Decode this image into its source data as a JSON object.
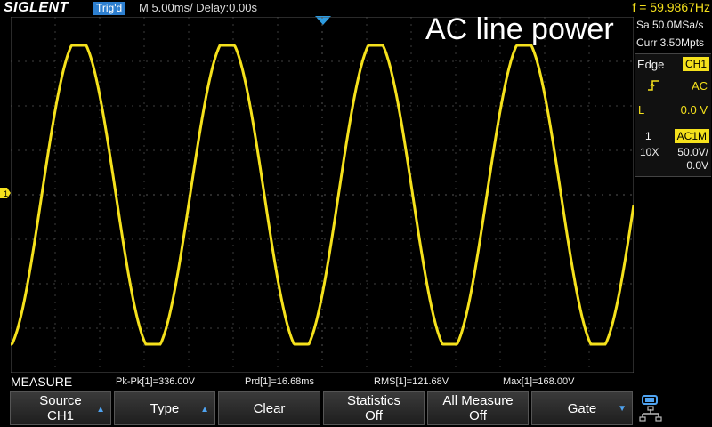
{
  "header": {
    "brand": "SIGLENT",
    "trigger_status": "Trig'd",
    "timebase": "M 5.00ms/ Delay:0.00s",
    "frequency": "f = 59.9867Hz"
  },
  "overlay_title": "AC line power",
  "acquisition": {
    "sample_rate": "Sa 50.0MSa/s",
    "memory": "Curr 3.50Mpts"
  },
  "trigger_panel": {
    "type": "Edge",
    "source": "CH1",
    "slope_icon": "rising-edge-icon",
    "coupling": "AC",
    "level_label": "L",
    "level_value": "0.0 V"
  },
  "channel_panel": {
    "number": "1",
    "coupling": "AC1M",
    "probe": "10X",
    "volts_per_div": "50.0V/",
    "offset": "0.0V"
  },
  "measure": {
    "title": "MEASURE",
    "items": [
      {
        "label": "Pk-Pk[1]=336.00V"
      },
      {
        "label": "Prd[1]=16.68ms"
      },
      {
        "label": "RMS[1]=121.68V"
      },
      {
        "label": "Max[1]=168.00V"
      }
    ]
  },
  "softkeys": [
    {
      "line1": "Source",
      "line2": "CH1",
      "arrow": "up"
    },
    {
      "line1": "Type",
      "line2": "",
      "arrow": "up"
    },
    {
      "line1": "Clear",
      "line2": "",
      "arrow": ""
    },
    {
      "line1": "Statistics",
      "line2": "Off",
      "arrow": ""
    },
    {
      "line1": "All Measure",
      "line2": "Off",
      "arrow": ""
    },
    {
      "line1": "Gate",
      "line2": "",
      "arrow": "down"
    }
  ],
  "colors": {
    "trace": "#f5e11c",
    "grid": "#555555",
    "accent": "#2d7fd0"
  },
  "channel_marker_label": "1",
  "chart_data": {
    "type": "line",
    "series": [
      {
        "name": "",
        "frequency_hz": 59.9867,
        "amplitude_v": 168.0,
        "offset_v": 0.0
      }
    ],
    "xlabel": "",
    "ylabel": "",
    "x_range_ms": [
      -35,
      35
    ],
    "y_range_v": [
      -200,
      200
    ],
    "grid": true
  }
}
